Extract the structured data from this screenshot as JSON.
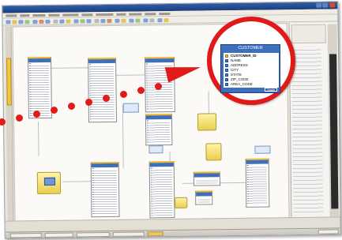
{
  "zoom_callout": {
    "table_name": "CUSTOMER",
    "fields": [
      {
        "name": "CUSTOMER_ID",
        "primary_key": true
      },
      {
        "name": "NAME",
        "primary_key": false
      },
      {
        "name": "ADDRESS",
        "primary_key": false
      },
      {
        "name": "CITY",
        "primary_key": false
      },
      {
        "name": "STATE",
        "primary_key": false
      },
      {
        "name": "ZIP_CODE",
        "primary_key": false
      },
      {
        "name": "AREA_CODE",
        "primary_key": false
      }
    ],
    "footer_label": "Oracle",
    "ring_color": "#e01919",
    "header_color": "#3d6fbd"
  },
  "icons": {
    "window_controls": [
      "minimize-icon",
      "maximize-icon",
      "close-icon"
    ],
    "left_tab": "explorer-tab-icon",
    "entities": [
      "laptop-entity-icon",
      "folder-entity-icon",
      "printer-entity-icon",
      "document-entity-icon"
    ]
  },
  "colors": {
    "accent_red": "#e01919",
    "table_header_blue": "#3f6fb8",
    "entity_yellow": "#e9cf4e"
  }
}
